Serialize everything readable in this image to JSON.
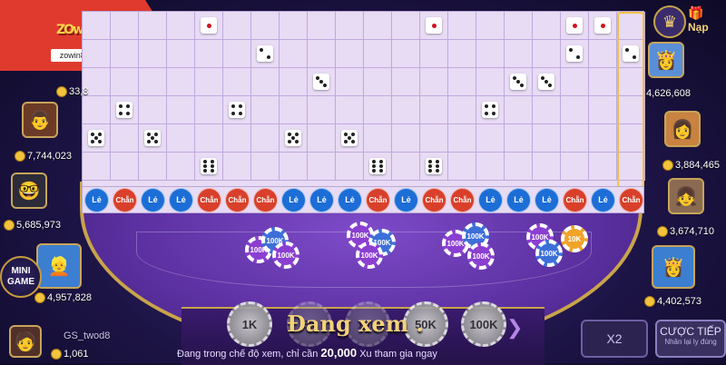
{
  "logo": {
    "brand": "ZOwin",
    "url": "zowin86.com"
  },
  "vip_icon": "crown-icon",
  "nap_label": "Nạp",
  "grid": {
    "columns": 20,
    "rows": 6,
    "dice": [
      {
        "col": 4,
        "row": 0,
        "face": 1
      },
      {
        "col": 12,
        "row": 0,
        "face": 1
      },
      {
        "col": 17,
        "row": 0,
        "face": 1
      },
      {
        "col": 18,
        "row": 0,
        "face": 1
      },
      {
        "col": 6,
        "row": 1,
        "face": 2
      },
      {
        "col": 17,
        "row": 1,
        "face": 2
      },
      {
        "col": 19,
        "row": 1,
        "face": 2
      },
      {
        "col": 8,
        "row": 2,
        "face": 3
      },
      {
        "col": 15,
        "row": 2,
        "face": 3
      },
      {
        "col": 16,
        "row": 2,
        "face": 3
      },
      {
        "col": 1,
        "row": 3,
        "face": 4
      },
      {
        "col": 5,
        "row": 3,
        "face": 4
      },
      {
        "col": 14,
        "row": 3,
        "face": 4
      },
      {
        "col": 0,
        "row": 4,
        "face": 5
      },
      {
        "col": 2,
        "row": 4,
        "face": 5
      },
      {
        "col": 7,
        "row": 4,
        "face": 5
      },
      {
        "col": 9,
        "row": 4,
        "face": 5
      },
      {
        "col": 4,
        "row": 5,
        "face": 6
      },
      {
        "col": 10,
        "row": 5,
        "face": 6
      },
      {
        "col": 12,
        "row": 5,
        "face": 6
      }
    ],
    "results": [
      "Lẻ",
      "Chẵn",
      "Lẻ",
      "Lẻ",
      "Chẵn",
      "Chẵn",
      "Chẵn",
      "Lẻ",
      "Lẻ",
      "Lẻ",
      "Chẵn",
      "Lẻ",
      "Chẵn",
      "Chẵn",
      "Lẻ",
      "Lẻ",
      "Lẻ",
      "Chẵn",
      "Lẻ",
      "Chẵn"
    ]
  },
  "players_left": [
    {
      "money": "33,8",
      "emoji": "👦"
    },
    {
      "money": "7,744,023",
      "emoji": "👨"
    },
    {
      "money": "5,685,973",
      "emoji": "🤓"
    },
    {
      "money": "4,957,828",
      "emoji": "👱"
    },
    {
      "name": "GS_twod8",
      "money": "1,061",
      "emoji": "🧑"
    }
  ],
  "players_right": [
    {
      "money": "4,626,608",
      "emoji": "👸"
    },
    {
      "money": "3,884,465",
      "emoji": "👩"
    },
    {
      "money": "3,674,710",
      "emoji": "👧"
    },
    {
      "money": "4,402,573",
      "emoji": "👸"
    }
  ],
  "minigame_label": "MINI\nGAME",
  "chip_values": [
    "1K",
    "5K",
    "10K",
    "50K",
    "100K"
  ],
  "table_chips": [
    "100K",
    "100K",
    "100K",
    "100K",
    "100K",
    "100K",
    "100K",
    "100K",
    "100K",
    "100K",
    "100K",
    "100K",
    "10K"
  ],
  "watch_text": "Đang xem .",
  "note_prefix": "Đang trong chế độ xem, chỉ cần",
  "note_amount": "20,000",
  "note_suffix": "Xu tham gia ngay",
  "x2_label": "X2",
  "cuoc_label": "CƯỢC TIẾP",
  "cuoc_sub": "Nhân lại ly đúng"
}
